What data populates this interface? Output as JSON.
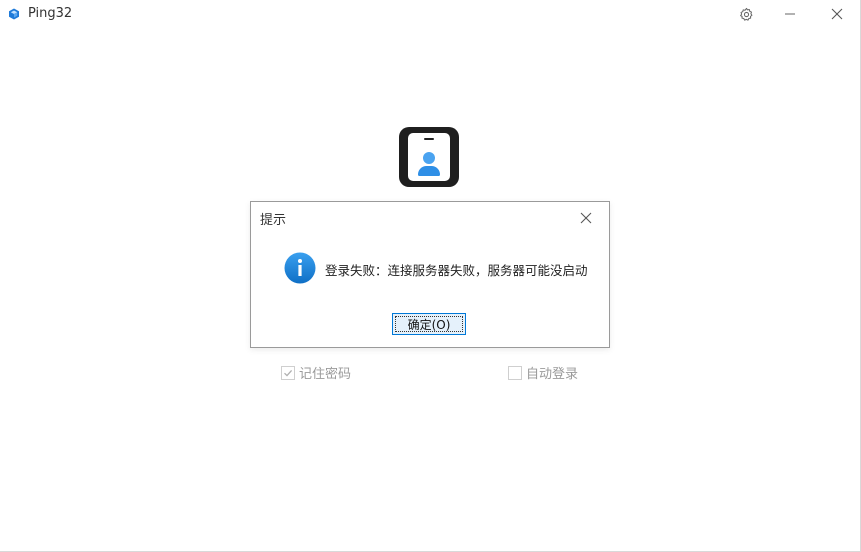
{
  "window": {
    "title": "Ping32",
    "accent_color": "#1e7ad9"
  },
  "titlebar": {
    "app_icon": "cube-icon",
    "settings_icon": "gear-icon",
    "minimize_icon": "minimize-icon",
    "close_icon": "close-icon"
  },
  "login": {
    "logo_icon": "id-badge-icon",
    "remember_password": {
      "label": "记住密码",
      "checked": true,
      "disabled": true
    },
    "auto_login": {
      "label": "自动登录",
      "checked": false,
      "disabled": true
    }
  },
  "dialog": {
    "title": "提示",
    "icon": "info-icon",
    "icon_color": "#1a7fd4",
    "message": "登录失败：连接服务器失败，服务器可能没启动",
    "ok_label": "确定(O)",
    "close_icon": "close-icon"
  }
}
